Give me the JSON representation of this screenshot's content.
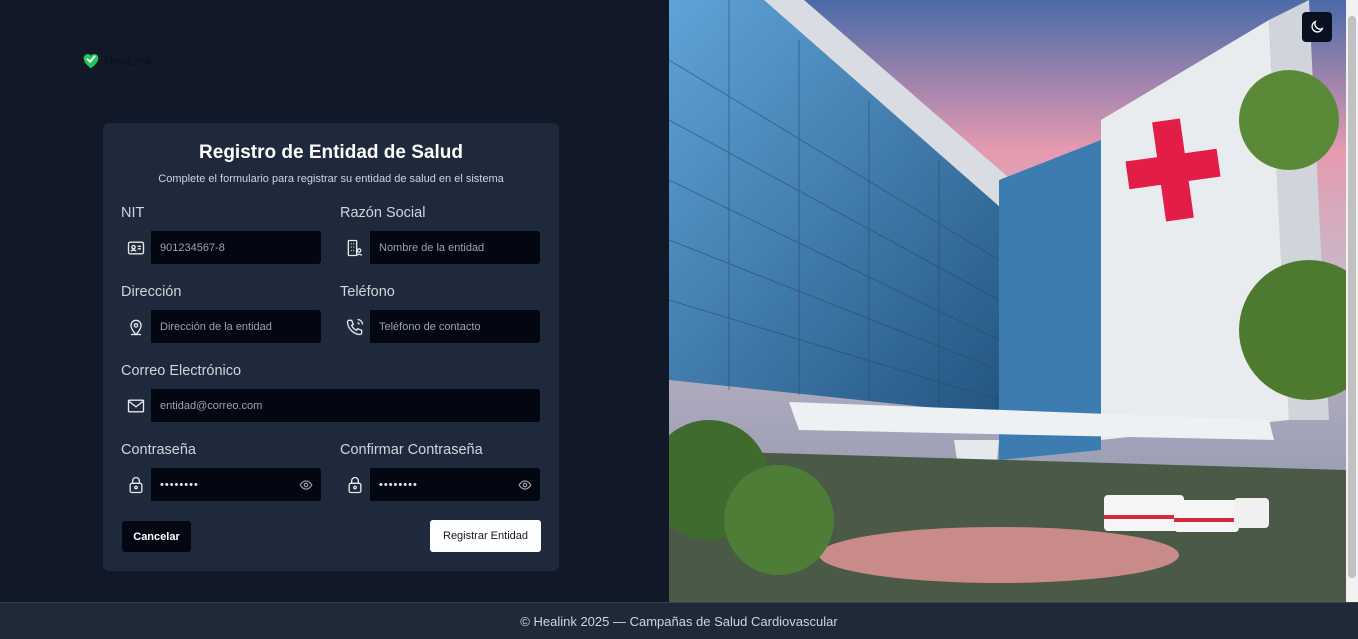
{
  "brand": {
    "name": "HeaLink"
  },
  "form": {
    "title": "Registro de Entidad de Salud",
    "subtitle": "Complete el formulario para registrar su entidad de salud en el sistema",
    "nit": {
      "label": "NIT",
      "placeholder": "901234567-8"
    },
    "razon_social": {
      "label": "Razón Social",
      "placeholder": "Nombre de la entidad"
    },
    "direccion": {
      "label": "Dirección",
      "placeholder": "Dirección de la entidad"
    },
    "telefono": {
      "label": "Teléfono",
      "placeholder": "Teléfono de contacto"
    },
    "correo": {
      "label": "Correo Electrónico",
      "placeholder": "entidad@correo.com"
    },
    "contrasena": {
      "label": "Contraseña",
      "value": "••••••••"
    },
    "confirmar": {
      "label": "Confirmar Contraseña",
      "value": "••••••••"
    },
    "cancel_label": "Cancelar",
    "submit_label": "Registrar Entidad"
  },
  "footer": {
    "text": "© Healink 2025 — Campañas de Salud Cardiovascular"
  },
  "icons": {
    "theme": "moon-icon",
    "nit": "id-card-icon",
    "razon_social": "building-icon",
    "direccion": "map-pin-icon",
    "telefono": "phone-icon",
    "correo": "mail-icon",
    "password": "lock-icon",
    "toggle": "eye-icon"
  },
  "colors": {
    "background": "#111827",
    "card": "#1e293b",
    "input": "#030712",
    "accent_red": "#e11d48",
    "brand_green": "#22c55e"
  }
}
